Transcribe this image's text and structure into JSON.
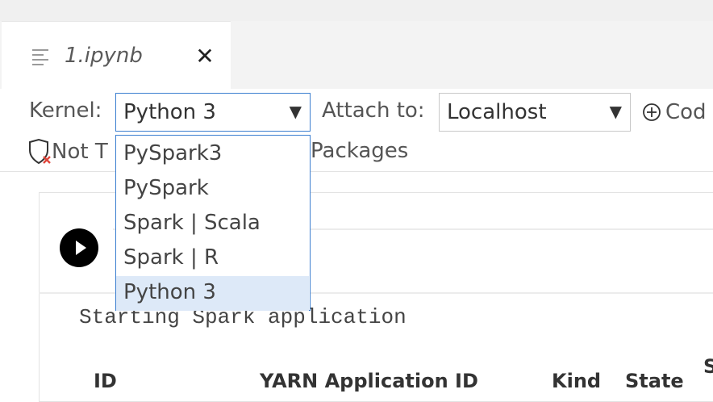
{
  "tab": {
    "title": "1.ipynb",
    "close_icon": "close-icon"
  },
  "toolbar": {
    "kernel_label": "Kernel:",
    "kernel_value": "Python 3",
    "attach_label": "Attach to:",
    "attach_value": "Localhost",
    "code_label": "Cod",
    "trust_label": "Not T",
    "packages_label": "Packages"
  },
  "kernel_dropdown": {
    "options": [
      "PySpark3",
      "PySpark",
      "Spark | Scala",
      "Spark | R",
      "Python 3"
    ],
    "selected": "Python 3"
  },
  "cell": {
    "output_text": "Starting Spark application",
    "table_headers": [
      "ID",
      "YARN Application ID",
      "Kind",
      "State",
      "S"
    ]
  },
  "colors": {
    "accent": "#3c7fd0",
    "selected_bg": "#dde9f8"
  }
}
